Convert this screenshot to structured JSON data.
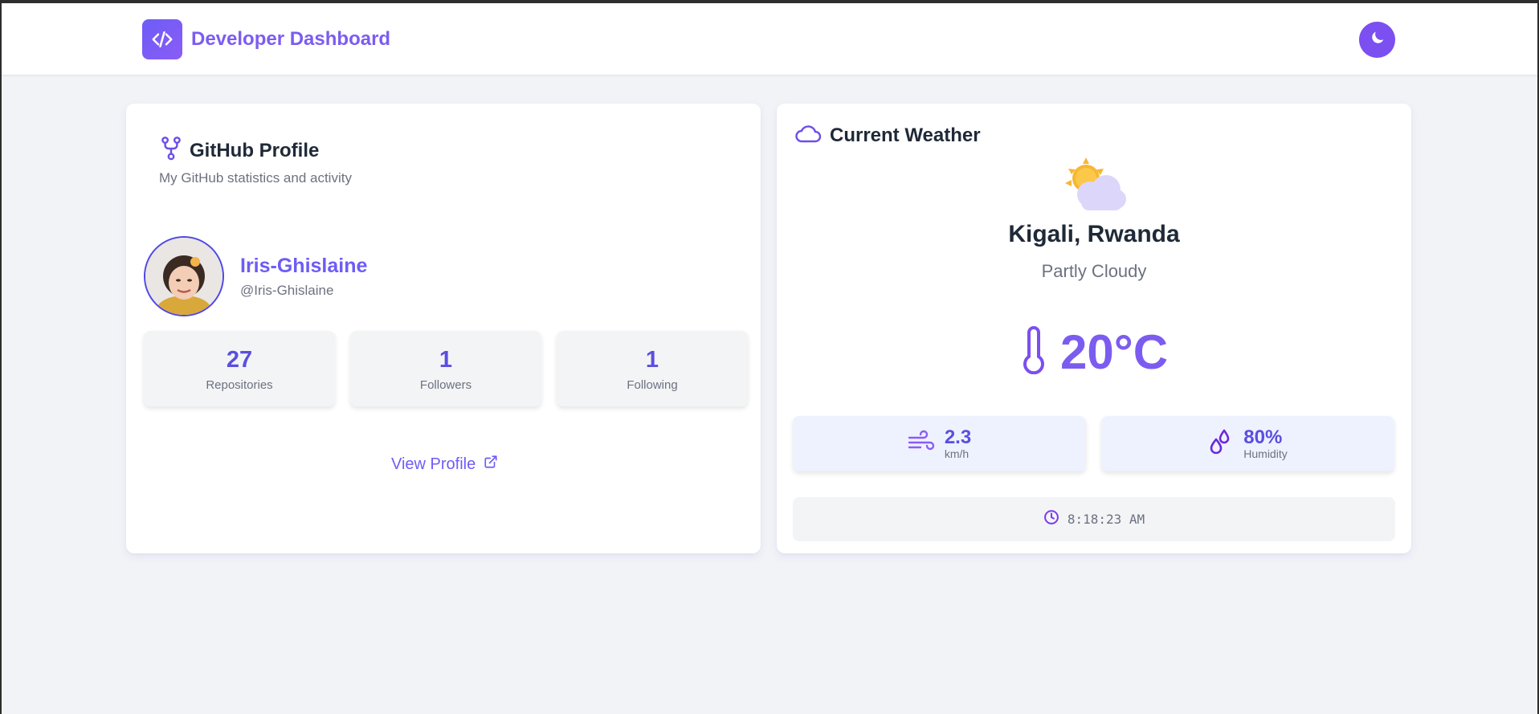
{
  "header": {
    "title": "Developer Dashboard",
    "logo_icon": "code-icon",
    "theme_toggle_icon": "moon-icon"
  },
  "github": {
    "title": "GitHub Profile",
    "subtitle": "My GitHub statistics and activity",
    "icon": "git-fork-icon",
    "username": "Iris-Ghislaine",
    "handle": "@Iris-Ghislaine",
    "stats": [
      {
        "value": "27",
        "label": "Repositories"
      },
      {
        "value": "1",
        "label": "Followers"
      },
      {
        "value": "1",
        "label": "Following"
      }
    ],
    "view_profile": "View Profile",
    "view_profile_icon": "external-link-icon"
  },
  "weather": {
    "title": "Current Weather",
    "icon": "cloud-icon",
    "condition_icon": "partly-cloudy-icon",
    "location": "Kigali, Rwanda",
    "condition": "Partly Cloudy",
    "temperature": "20°C",
    "temperature_icon": "thermometer-icon",
    "wind": {
      "value": "2.3",
      "unit": "km/h",
      "icon": "wind-icon"
    },
    "humidity": {
      "value": "80%",
      "label": "Humidity",
      "icon": "droplets-icon"
    },
    "time": "8:18:23 AM",
    "time_icon": "clock-icon"
  },
  "colors": {
    "accent": "#7c5cf0",
    "accent_dark": "#5b4ee0",
    "background": "#f2f3f6",
    "card": "#ffffff"
  }
}
